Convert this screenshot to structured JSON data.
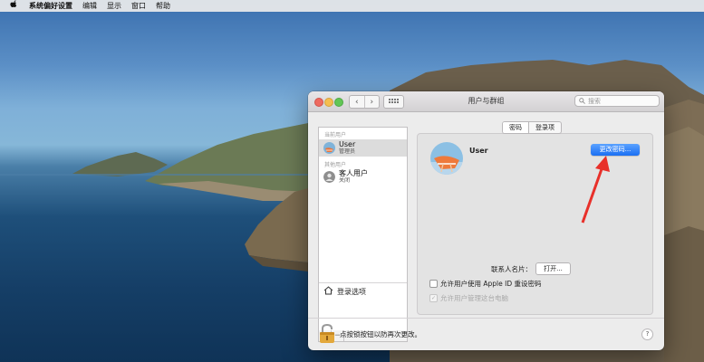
{
  "menubar": {
    "apple_icon": "apple-logo-icon",
    "items": [
      "系统偏好设置",
      "编辑",
      "显示",
      "窗口",
      "帮助"
    ]
  },
  "window": {
    "title": "用户与群组",
    "search": {
      "placeholder": "搜索",
      "icon": "search-icon"
    },
    "nav": {
      "back_icon": "chevron-left-icon",
      "forward_icon": "chevron-right-icon",
      "grid_icon": "grid-icon"
    }
  },
  "sidebar": {
    "current_section": "当前用户",
    "current_user": {
      "name": "User",
      "role": "管理员"
    },
    "other_section": "其他用户",
    "other_users": [
      {
        "name": "客人用户",
        "status": "关闭"
      }
    ],
    "login_options": "登录选项",
    "add_icon": "+",
    "remove_icon": "−"
  },
  "tabs": [
    "密码",
    "登录项"
  ],
  "active_tab": "密码",
  "user": {
    "name": "User"
  },
  "change_password_button": "更改密码...",
  "contact_card": {
    "label": "联系人名片：",
    "button": "打开..."
  },
  "checkboxes": [
    {
      "label": "允许用户使用 Apple ID 重设密码",
      "checked": false,
      "enabled": true
    },
    {
      "label": "允许用户管理这台电脑",
      "checked": true,
      "enabled": false
    }
  ],
  "lock_text": "点按锁按钮以防再次更改。",
  "help_label": "?",
  "colors": {
    "accent_button": "#1b6ff3",
    "annotation_arrow": "#e8302a"
  }
}
